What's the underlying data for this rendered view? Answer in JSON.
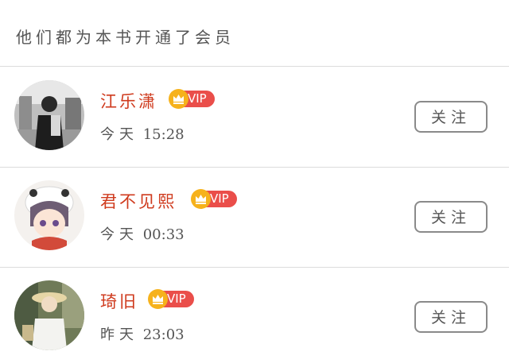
{
  "header": {
    "title": "他们都为本书开通了会员"
  },
  "members": [
    {
      "name": "江乐潇",
      "badge": "VIP",
      "date": "今天",
      "time": "15:28",
      "follow_label": "关注",
      "avatar": "avatar-photo-street"
    },
    {
      "name": "君不见熙",
      "badge": "VIP",
      "date": "今天",
      "time": "00:33",
      "follow_label": "关注",
      "avatar": "avatar-anime-character"
    },
    {
      "name": "琦旧",
      "badge": "VIP",
      "date": "昨天",
      "time": "23:03",
      "follow_label": "关注",
      "avatar": "avatar-photo-hat"
    }
  ],
  "colors": {
    "name": "#cf3a1d",
    "vip_pill": "#ea4e4a",
    "crown": "#f6b21c",
    "divider": "#dcdcdc",
    "button_border": "#8a8a8a",
    "secondary_text": "#555555"
  },
  "icons": {
    "vip_crown": "crown-icon"
  }
}
